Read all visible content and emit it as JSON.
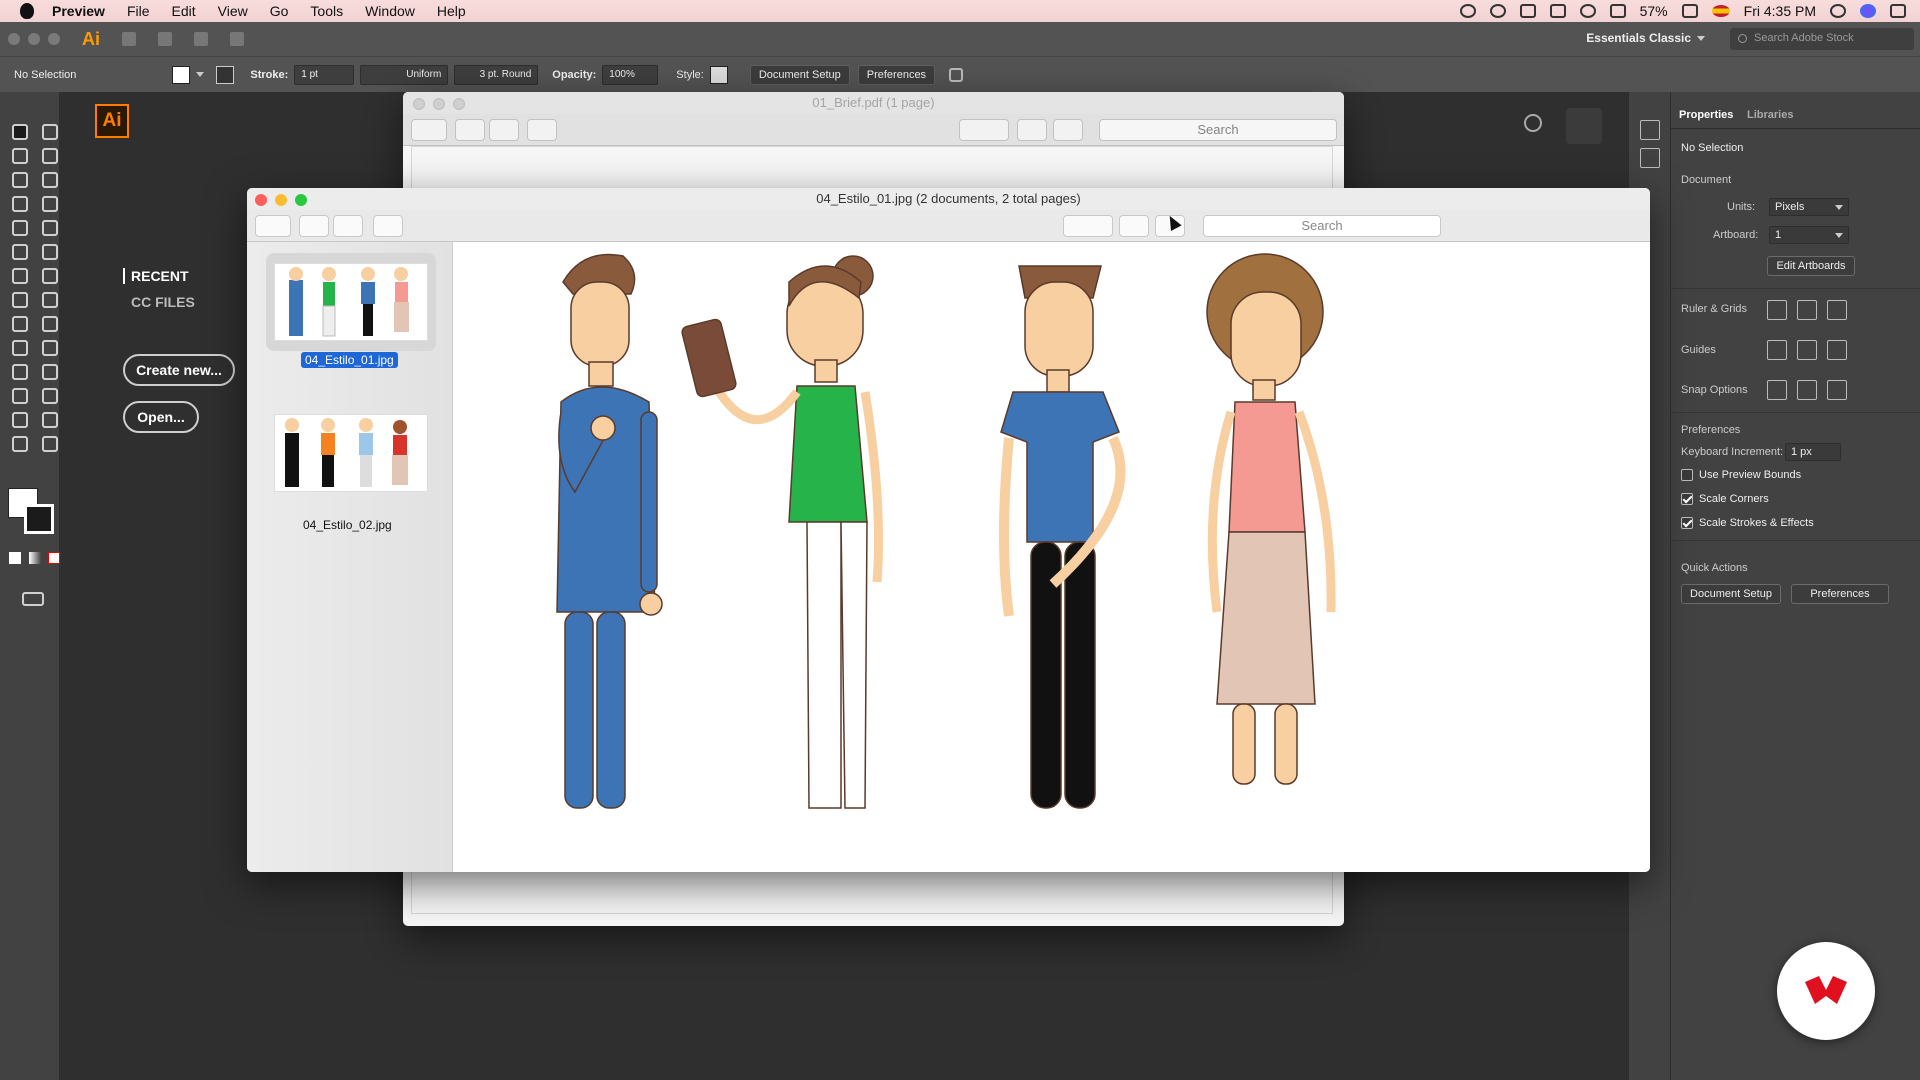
{
  "menubar": {
    "app": "Preview",
    "items": [
      "File",
      "Edit",
      "View",
      "Go",
      "Tools",
      "Window",
      "Help"
    ],
    "battery": "57%",
    "clock": "Fri 4:35 PM"
  },
  "illustrator": {
    "logo_small": "Ai",
    "workspace": "Essentials Classic",
    "stock_search_placeholder": "Search Adobe Stock",
    "control": {
      "selection": "No Selection",
      "stroke_label": "Stroke:",
      "stroke_value": "1 pt",
      "profile": "Uniform",
      "brush": "3 pt. Round",
      "opacity_label": "Opacity:",
      "opacity_value": "100%",
      "style_label": "Style:",
      "document_setup": "Document Setup",
      "preferences": "Preferences"
    },
    "start": {
      "logo": "Ai",
      "recent": "RECENT",
      "cc_files": "CC FILES",
      "create_new": "Create new...",
      "open": "Open..."
    },
    "properties": {
      "tab_properties": "Properties",
      "tab_libraries": "Libraries",
      "no_selection": "No Selection",
      "document": "Document",
      "units_label": "Units:",
      "units_value": "Pixels",
      "artboard_label": "Artboard:",
      "artboard_value": "1",
      "edit_artboards": "Edit Artboards",
      "ruler_grids": "Ruler & Grids",
      "guides": "Guides",
      "snap_options": "Snap Options",
      "preferences_section": "Preferences",
      "keyboard_increment_label": "Keyboard Increment:",
      "keyboard_increment_value": "1 px",
      "use_preview_bounds": "Use Preview Bounds",
      "use_preview_bounds_checked": false,
      "scale_corners": "Scale Corners",
      "scale_corners_checked": true,
      "scale_strokes": "Scale Strokes & Effects",
      "scale_strokes_checked": true,
      "quick_actions": "Quick Actions",
      "qa_document_setup": "Document Setup",
      "qa_preferences": "Preferences"
    }
  },
  "preview_back": {
    "title": "01_Brief.pdf (1 page)",
    "search_placeholder": "Search"
  },
  "preview_front": {
    "title": "04_Estilo_01.jpg (2 documents, 2 total pages)",
    "search_placeholder": "Search",
    "thumbnails": [
      {
        "label": "04_Estilo_01.jpg",
        "selected": true
      },
      {
        "label": "04_Estilo_02.jpg",
        "selected": false
      }
    ]
  },
  "colors": {
    "ai_orange": "#ff7c00",
    "selection_blue": "#1f66d6",
    "suit_blue": "#3d74b6",
    "shirt_green": "#26b34a",
    "top_pink": "#f49a92",
    "skin": "#f8cfa0",
    "brand_red": "#e0101e"
  },
  "icons": [
    "apple-icon",
    "search-icon",
    "wifi-icon",
    "volume-icon",
    "battery-icon",
    "siri-icon",
    "zoom-in-icon",
    "zoom-out-icon",
    "share-icon",
    "rotate-icon",
    "markup-icon",
    "toolbox-icon",
    "sidebar-toggle-icon"
  ]
}
